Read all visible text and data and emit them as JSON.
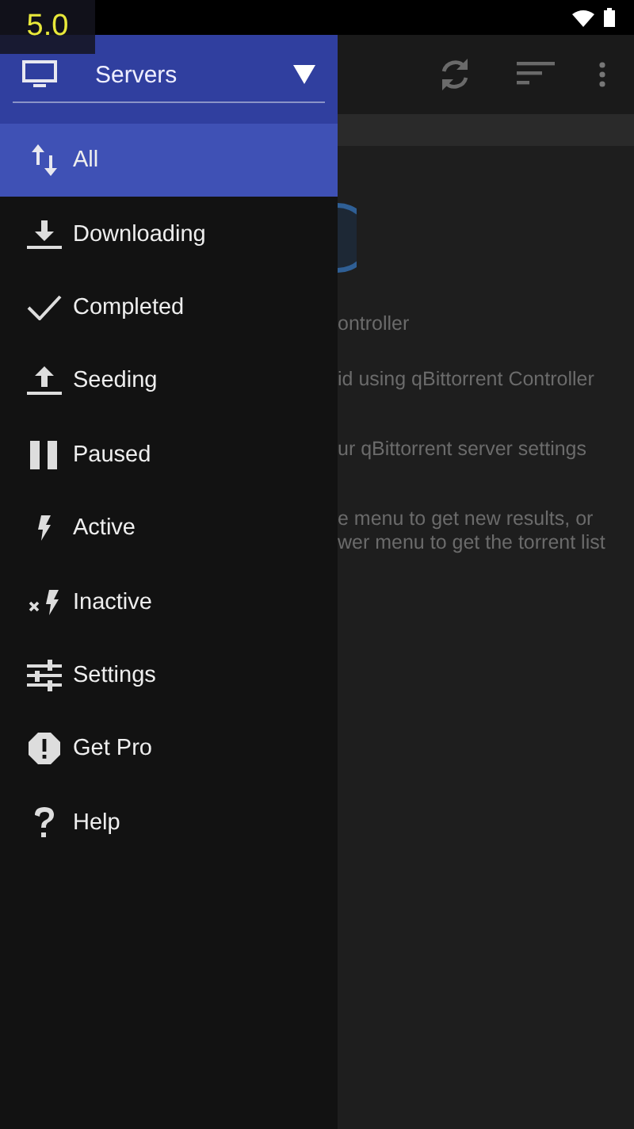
{
  "version_badge": "5.0",
  "drawer": {
    "server_selector": {
      "label": "Servers"
    },
    "items": [
      {
        "label": "All",
        "selected": true
      },
      {
        "label": "Downloading",
        "selected": false
      },
      {
        "label": "Completed",
        "selected": false
      },
      {
        "label": "Seeding",
        "selected": false
      },
      {
        "label": "Paused",
        "selected": false
      },
      {
        "label": "Active",
        "selected": false
      },
      {
        "label": "Inactive",
        "selected": false
      },
      {
        "label": "Settings",
        "selected": false
      },
      {
        "label": "Get Pro",
        "selected": false
      },
      {
        "label": "Help",
        "selected": false
      }
    ]
  },
  "content": {
    "lines": [
      "ontroller",
      "id using qBittorrent Controller",
      "ur qBittorrent server settings",
      "e menu to get new results, or",
      "wer menu to get the torrent list"
    ]
  }
}
